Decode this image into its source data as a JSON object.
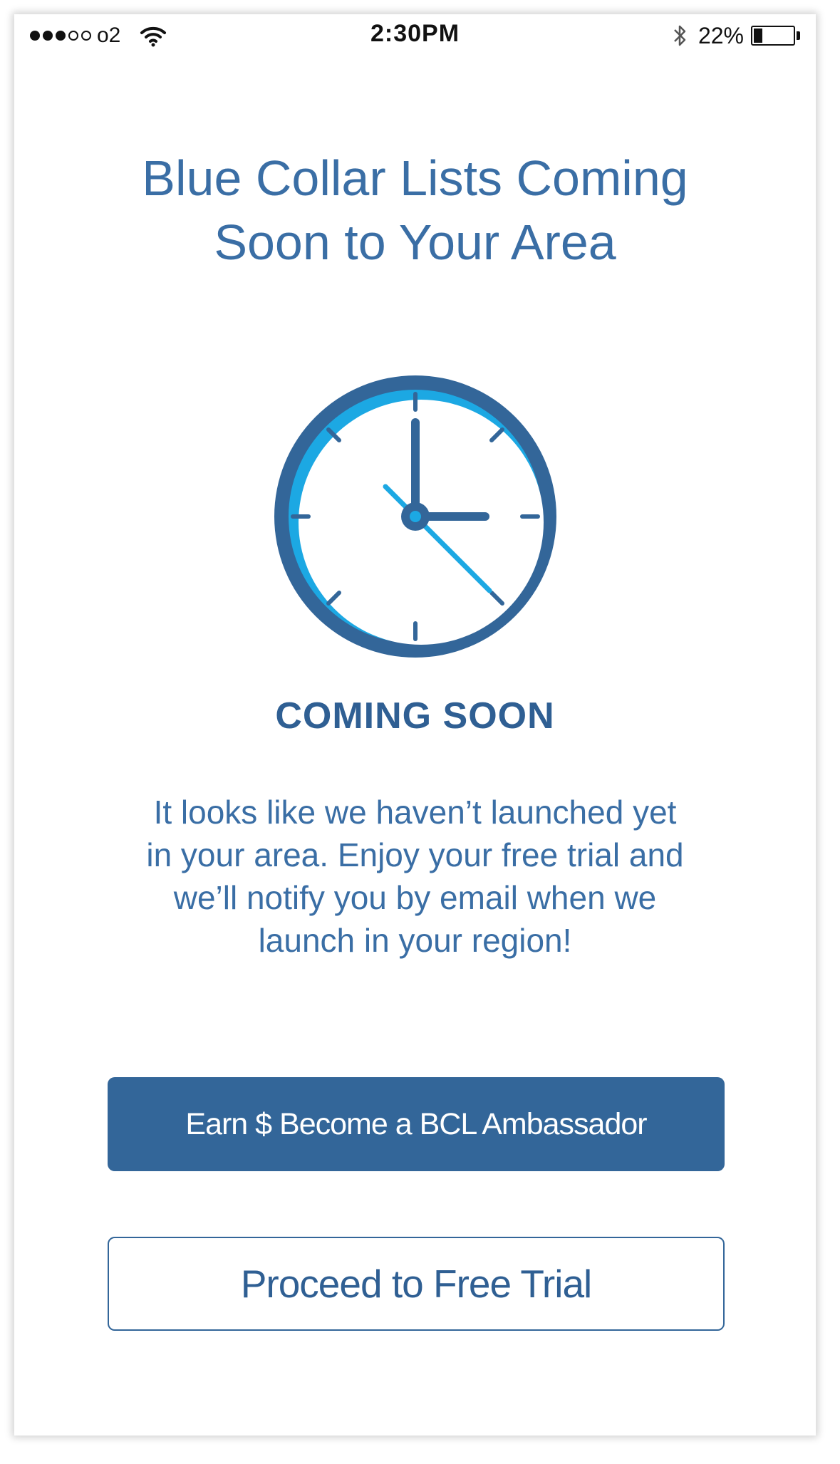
{
  "status_bar": {
    "signal_dots_filled": 3,
    "signal_dots_total": 5,
    "carrier": "o2",
    "time": "2:30PM",
    "battery_percent_text": "22%",
    "battery_level": 0.22,
    "icons": [
      "wifi-icon",
      "bluetooth-icon",
      "battery-icon"
    ]
  },
  "title": {
    "line1": "Blue Collar Lists Coming",
    "line2": "Soon to Your Area"
  },
  "illustration": {
    "icon": "clock-icon",
    "label": "COMING SOON"
  },
  "message": {
    "line1": "It looks like we haven’t launched yet",
    "line2": "in your area.  Enjoy your free trial and",
    "line3": "we’ll notify you by email when we",
    "line4": "launch in your region!"
  },
  "buttons": {
    "ambassador_label": "Earn $ Become a BCL Ambassador",
    "trial_label": "Proceed to Free Trial"
  },
  "colors": {
    "primary": "#336699",
    "accent": "#1ca8e3",
    "text_blue": "#3a6ea5"
  }
}
